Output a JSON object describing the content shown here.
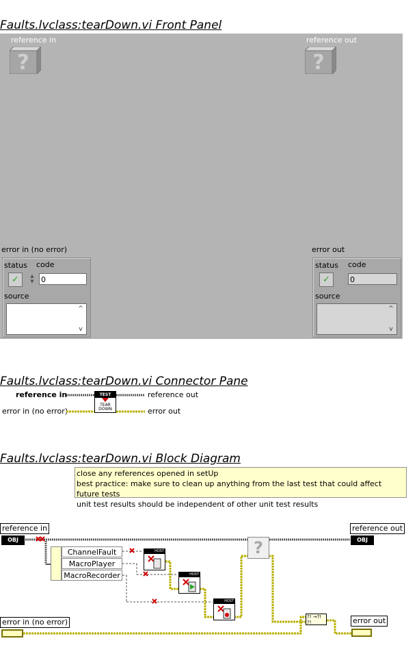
{
  "front_panel": {
    "title": "Faults.lvclass:tearDown.vi Front Panel",
    "reference_in_label": "reference in",
    "reference_out_label": "reference out",
    "error_in": {
      "label": "error in (no error)",
      "status_label": "status",
      "code_label": "code",
      "code_value": "0",
      "source_label": "source"
    },
    "error_out": {
      "label": "error out",
      "status_label": "status",
      "code_label": "code",
      "code_value": "0",
      "source_label": "source"
    }
  },
  "connector_pane": {
    "title": "Faults.lvclass:tearDown.vi Connector Pane",
    "left_terminals": [
      "reference in",
      "error in (no error)"
    ],
    "right_terminals": [
      "reference out",
      "error out"
    ],
    "icon_lines": [
      "TEST",
      "TEAR",
      "DOWN"
    ]
  },
  "block_diagram": {
    "title": "Faults.lvclass:tearDown.vi Block Diagram",
    "comment_lines": [
      "close any references opened in setUp",
      "best practice: make sure to clean up anything from the last test that could affect future tests",
      "unit test results should be independent of other unit test results"
    ],
    "terminals": {
      "reference_in": "reference in",
      "reference_out": "reference out",
      "error_in": "error in (no error)",
      "error_out": "error out",
      "obj_tag": "OBJ"
    },
    "bundle_items": [
      "ChannelFault",
      "MacroPlayer",
      "MacroRecorder"
    ],
    "host_label": "HOST",
    "question_glyph": "?"
  }
}
